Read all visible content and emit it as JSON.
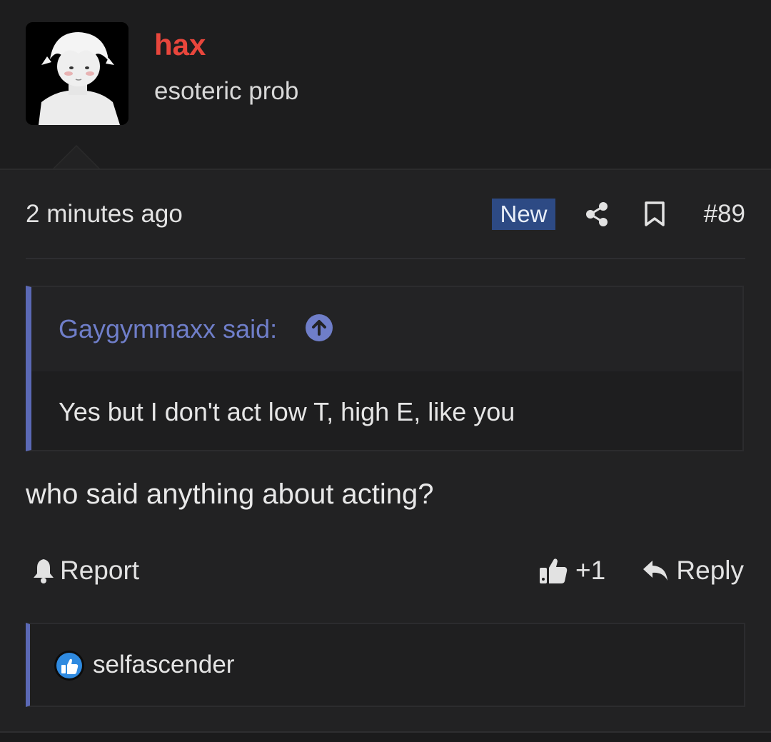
{
  "user": {
    "name": "hax",
    "title": "esoteric prob",
    "name_color": "#e8463c"
  },
  "post": {
    "timestamp": "2 minutes ago",
    "badge": "New",
    "number": "#89",
    "message": "who said anything about acting?",
    "icons": [
      "share-icon",
      "bookmark-icon"
    ]
  },
  "quote": {
    "author": "Gaygymmaxx said:",
    "text": "Yes but I don't act low T, high E, like you",
    "accent_color": "#5b69b5"
  },
  "actions": {
    "report_label": "Report",
    "like_count": "+1",
    "reply_label": "Reply"
  },
  "reactions": {
    "user": "selfascender",
    "icon": "thumbs-up-icon"
  }
}
